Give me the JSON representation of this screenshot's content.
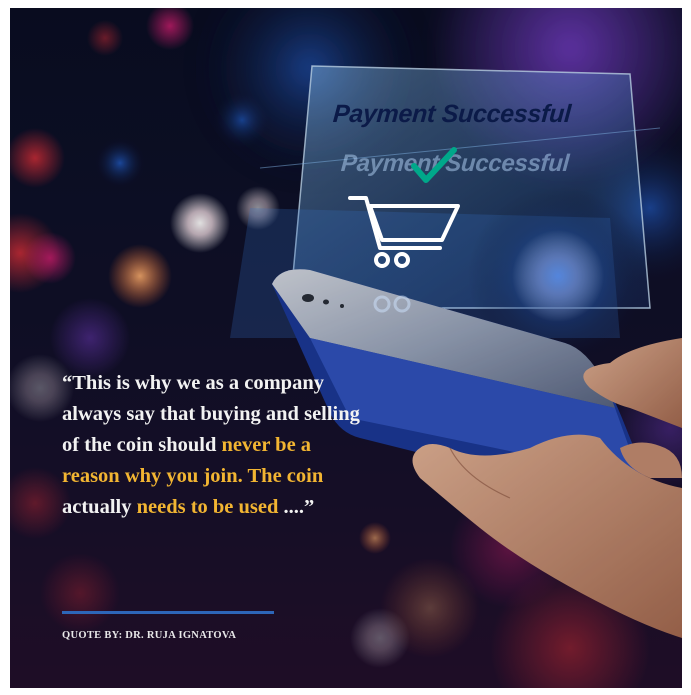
{
  "hud": {
    "title": "Payment Successful",
    "ghost_title": "Payment Successful",
    "cart_icon": "shopping-cart-icon",
    "check_icon": "checkmark-icon"
  },
  "quote": {
    "open": "“This is why we as a company always say that buying and selling of the coin should ",
    "hl1": "never be a reason why you join. The coin",
    "mid": " actually ",
    "hl2": "needs to be used",
    "close": " ....”"
  },
  "byline": {
    "prefix": "QUOTE BY: ",
    "name": "DR. RUJA IGNATOVA"
  },
  "colors": {
    "highlight": "#f2b532",
    "divider": "#2d66b8",
    "background": "#0b0e24"
  }
}
